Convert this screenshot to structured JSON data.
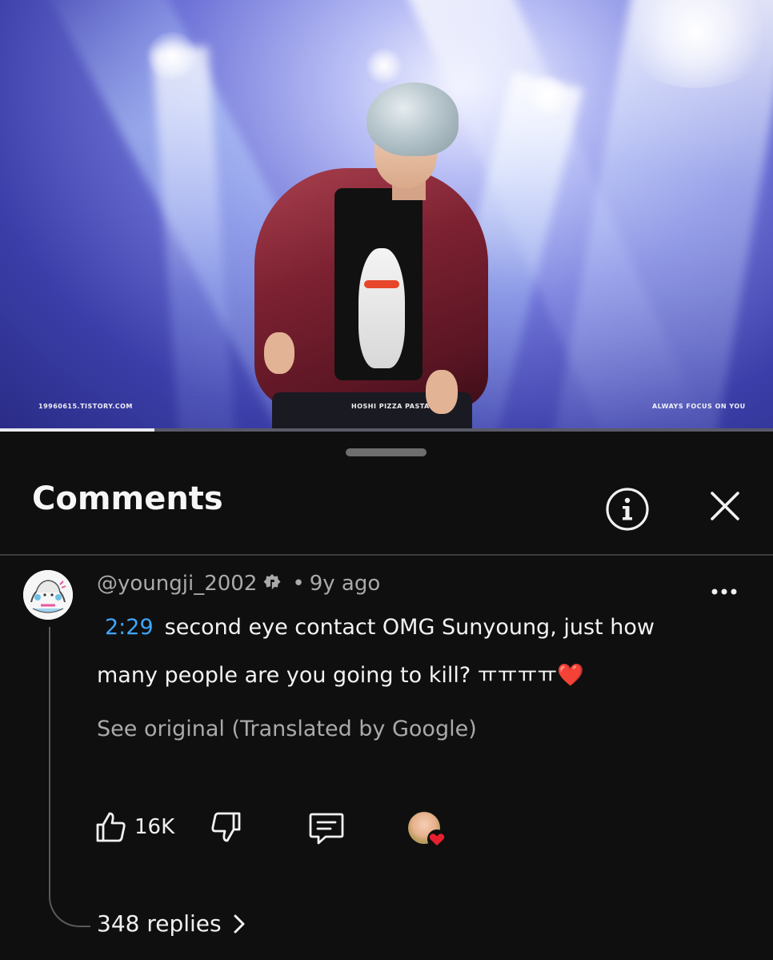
{
  "video": {
    "watermark_left": "19960615.TISTORY.COM",
    "watermark_center": "HOSHI PIZZA PASTA",
    "watermark_right": "ALWAYS FOCUS ON YOU",
    "progress_fraction": 0.2
  },
  "comments_panel": {
    "title": "Comments",
    "info_icon": "info-icon",
    "close_icon": "close-icon"
  },
  "comment": {
    "author": "@youngji_2002",
    "separator": "•",
    "age": "9y ago",
    "timestamp_link": "2:29",
    "text_line1": "second eye contact OMG Sunyoung,  just how",
    "text_line2": "many people are you going to kill?  ㅠㅠㅠㅠ❤️",
    "translation_note": "See original (Translated by Google)",
    "like_count": "16K",
    "replies_label": "348 replies",
    "colors": {
      "link": "#3ea6ff",
      "heart": "#e8202e"
    }
  }
}
